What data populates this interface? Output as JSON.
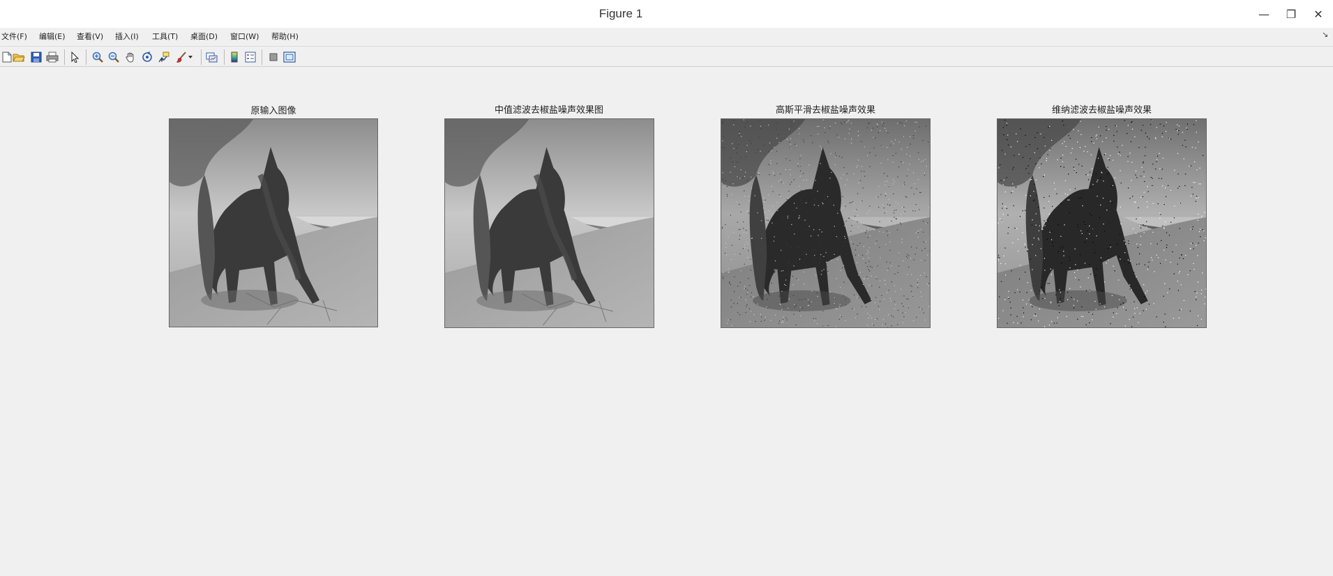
{
  "window": {
    "title": "Figure 1",
    "controls": {
      "minimize": "—",
      "restore": "❐",
      "close": "✕"
    }
  },
  "menubar": {
    "items": [
      "文件(F)",
      "编辑(E)",
      "查看(V)",
      "插入(I)",
      "工具(T)",
      "桌面(D)",
      "窗口(W)",
      "帮助(H)"
    ],
    "dock_icon": "↘"
  },
  "toolbar": {
    "tools": [
      "new-figure-icon",
      "open-file-icon",
      "save-icon",
      "print-icon",
      "pointer-icon",
      "zoom-in-icon",
      "zoom-out-icon",
      "pan-icon",
      "rotate-3d-icon",
      "data-cursor-icon",
      "brush-icon",
      "brush-dropdown-icon",
      "link-plot-icon",
      "colorbar-icon",
      "legend-icon",
      "hide-plot-tools-icon",
      "show-plot-tools-icon"
    ]
  },
  "subplots": [
    {
      "title": "原输入图像",
      "image": "grayscale unicorn on beach"
    },
    {
      "title": "中值滤波去椒盐噪声效果图",
      "image": "grayscale unicorn on beach"
    },
    {
      "title": "高斯平滑去椒盐噪声效果",
      "image": "grayscale unicorn on beach"
    },
    {
      "title": "维纳滤波去椒盐噪声效果",
      "image": "grayscale unicorn on beach"
    }
  ],
  "colors": {
    "background": "#f0f0f0",
    "titlebar": "#ffffff"
  }
}
